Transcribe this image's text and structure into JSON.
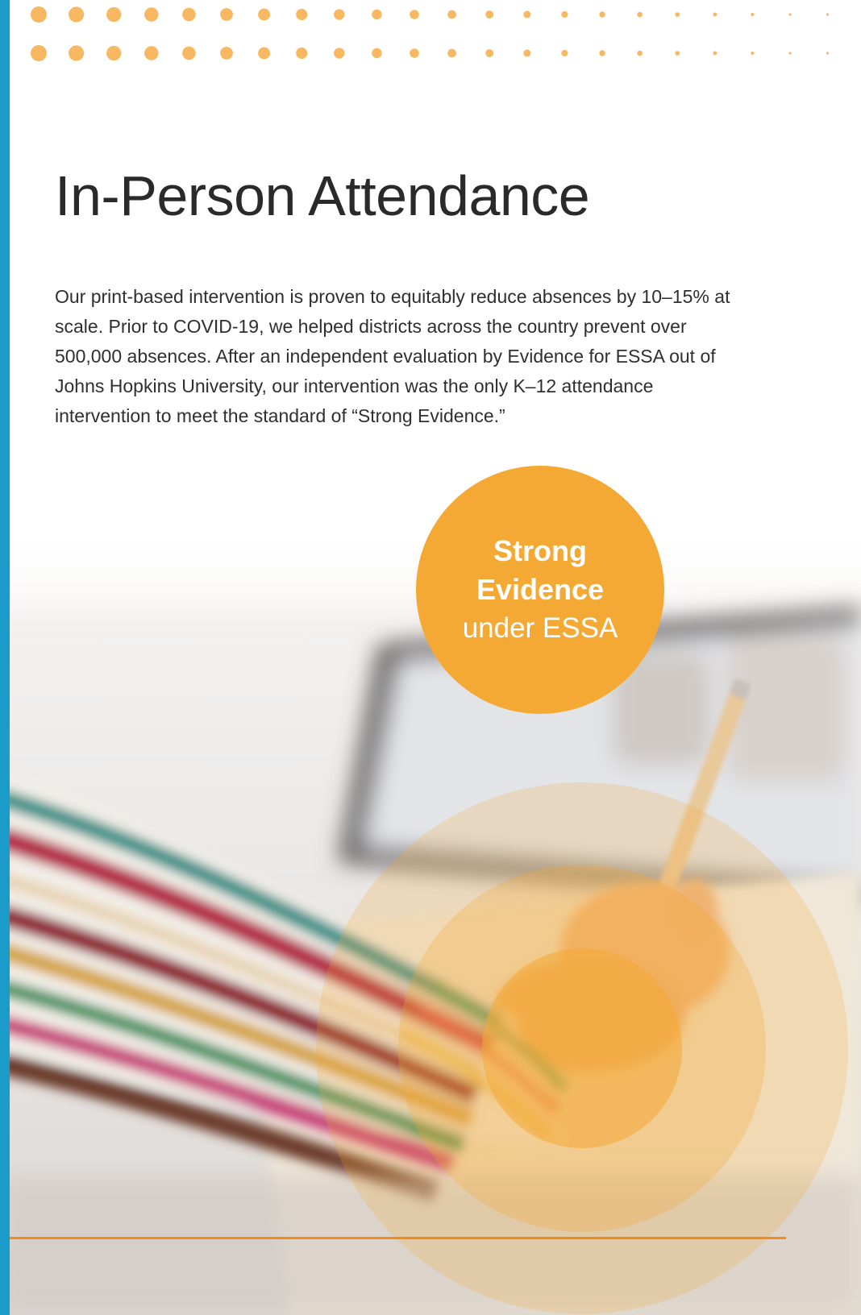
{
  "page": {
    "title": "In-Person Attendance",
    "body": "Our print-based intervention is proven to equitably reduce absences by 10–15% at scale. Prior to COVID-19, we helped districts across the country prevent over 500,000 absences. After an independent evaluation by Evidence for ESSA out of Johns Hopkins University, our intervention was the only K–12 attendance intervention to meet the standard of “Strong Evidence.”"
  },
  "badge": {
    "line1": "Strong",
    "line2": "Evidence",
    "line3": "under ESSA"
  },
  "colors": {
    "accent_orange": "#f4a934",
    "rule_orange": "#f28a1c",
    "side_bar_blue": "#1a9bc9",
    "dot_orange": "#f8b862"
  },
  "photo": {
    "description_icon": "child-writing-photo"
  }
}
